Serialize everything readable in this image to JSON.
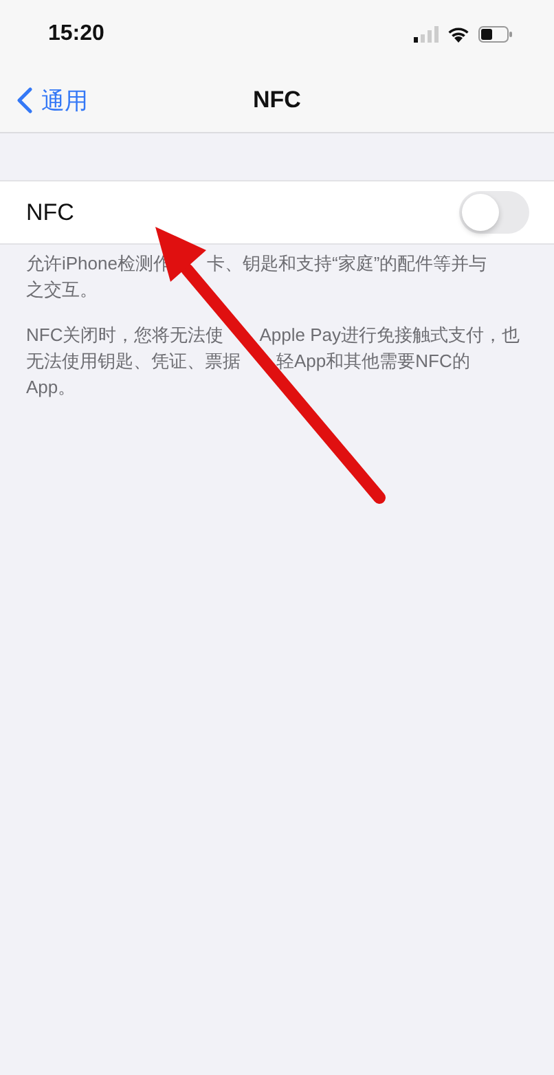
{
  "status_bar": {
    "time": "15:20"
  },
  "nav": {
    "back": "通用",
    "title": "NFC"
  },
  "setting": {
    "label": "NFC",
    "on": false
  },
  "footnotes": [
    {
      "lines": [
        [
          "允许iPhone检测作",
          "卡、钥匙和支持“家庭”的配件等并与"
        ],
        [
          "之交互。"
        ]
      ]
    },
    {
      "lines": [
        [
          "NFC关闭时，您将无法使",
          "Apple Pay进行免接触式支付，也"
        ],
        [
          "无法使用钥匙、凭证、票据",
          "轻App和其他需要NFC的"
        ],
        [
          "App。"
        ]
      ]
    }
  ],
  "annotation": {
    "kind": "arrow"
  }
}
